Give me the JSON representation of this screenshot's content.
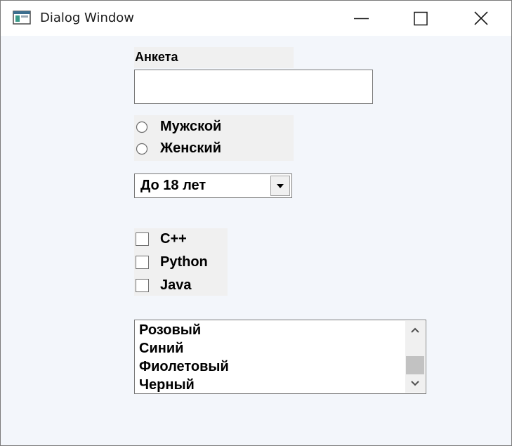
{
  "window": {
    "title": "Dialog Window",
    "icons": {
      "app": "application-icon",
      "minimize": "minimize-icon",
      "maximize": "maximize-icon",
      "close": "close-icon"
    }
  },
  "form": {
    "label": "Анкета",
    "name_input": {
      "value": "",
      "placeholder": ""
    },
    "gender": {
      "options": [
        "Мужской",
        "Женский"
      ],
      "selected": null
    },
    "age": {
      "selected": "До 18 лет"
    },
    "languages": [
      {
        "label": "C++",
        "checked": false
      },
      {
        "label": "Python",
        "checked": false
      },
      {
        "label": "Java",
        "checked": false
      }
    ],
    "colors": {
      "items": [
        "Розовый",
        "Синий",
        "Фиолетовый",
        "Черный"
      ]
    }
  },
  "colors": {
    "window_bg": "#f3f6fb",
    "control_bg": "#f0f0f0",
    "border": "#7a7a7a"
  }
}
